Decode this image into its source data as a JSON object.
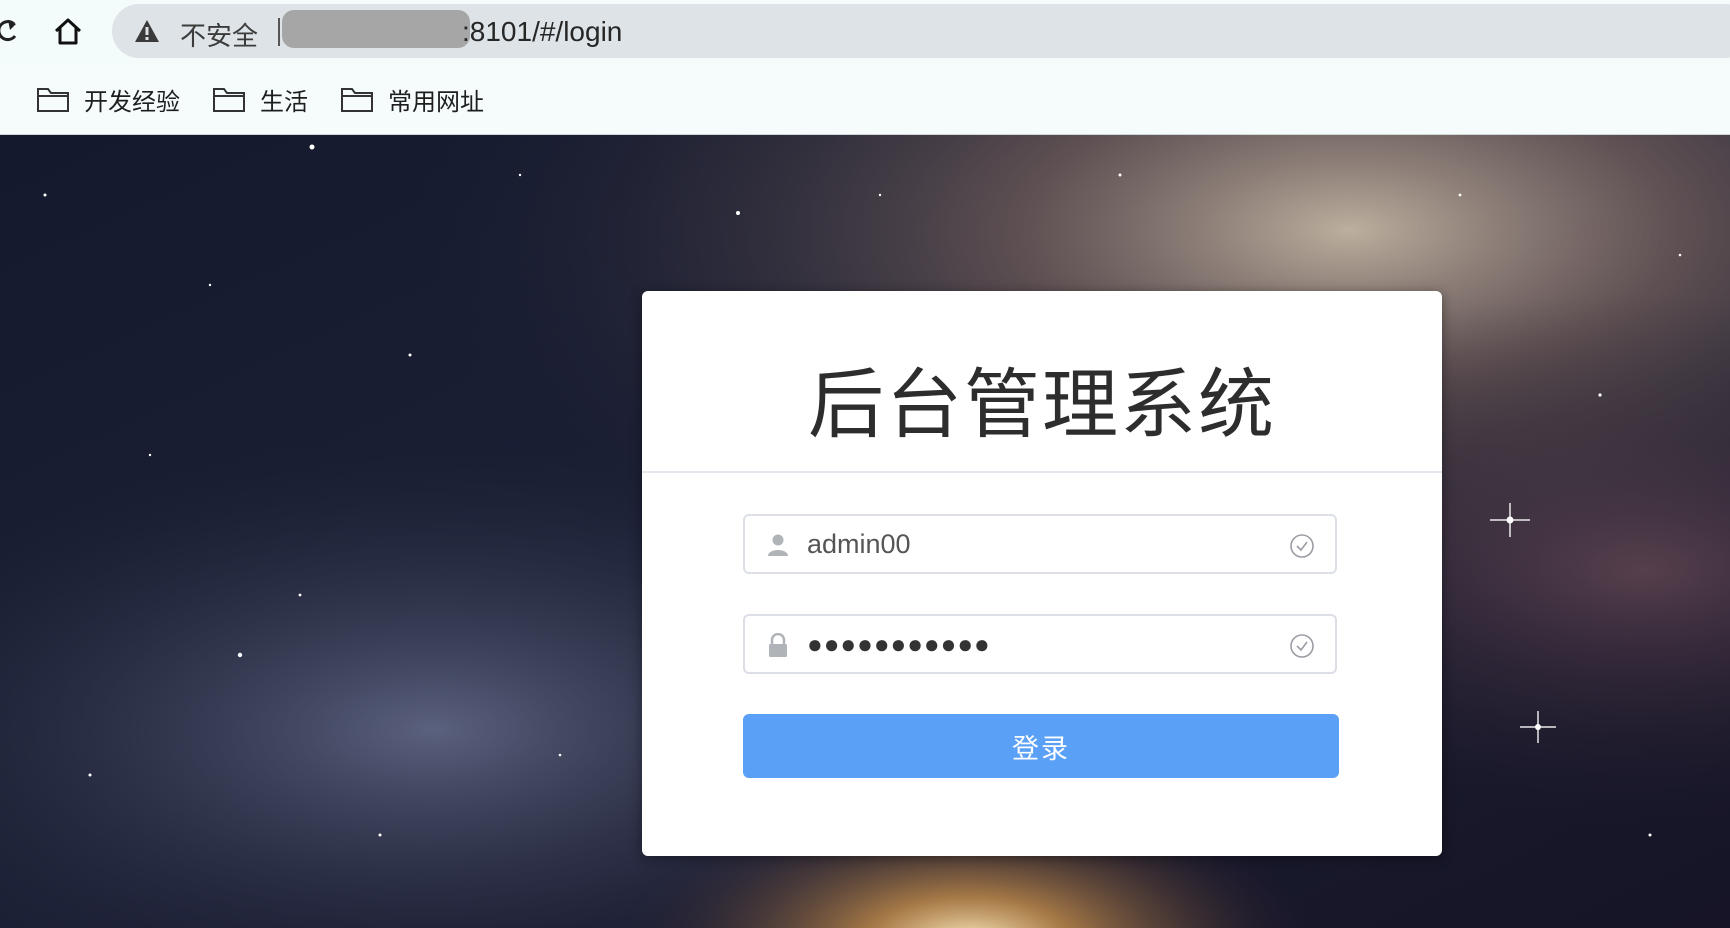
{
  "browser": {
    "security_label": "不安全",
    "url_visible": ":8101/#/login"
  },
  "bookmarks": [
    {
      "label": "开发经验"
    },
    {
      "label": "生活"
    },
    {
      "label": "常用网址"
    }
  ],
  "login": {
    "title": "后台管理系统",
    "username_value": "admin00",
    "password_masked": "●●●●●●●●●●●",
    "submit_label": "登录"
  },
  "colors": {
    "button": "#5aa0f6",
    "input_border": "#dcdfe6"
  }
}
